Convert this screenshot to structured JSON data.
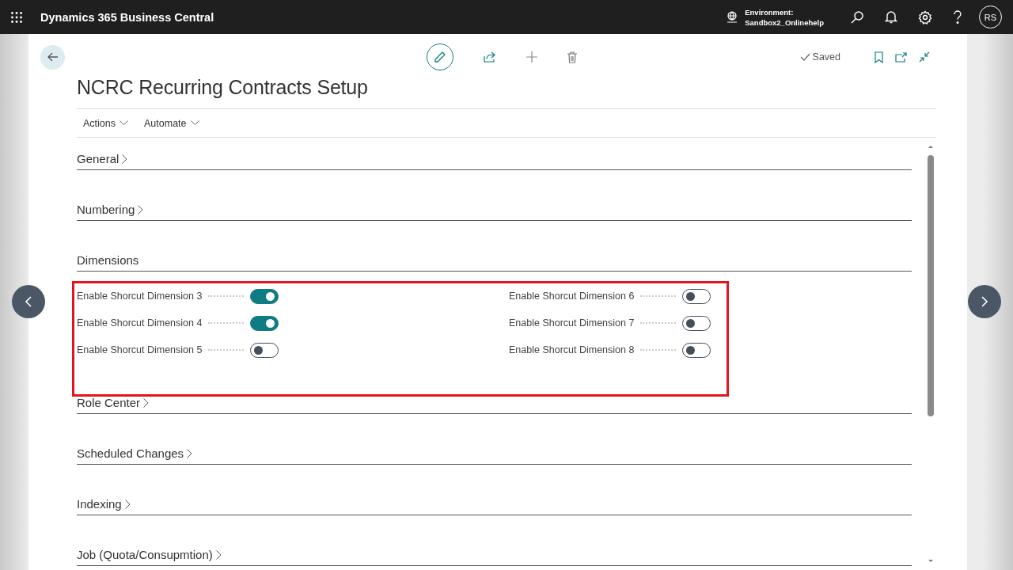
{
  "app_bar": {
    "title": "Dynamics 365 Business Central",
    "environment_label": "Environment:",
    "environment_name": "Sandbox2_Onlinehelp",
    "avatar": "RS"
  },
  "page": {
    "title": "NCRC Recurring Contracts Setup",
    "status": "Saved"
  },
  "action_menu": [
    {
      "label": "Actions"
    },
    {
      "label": "Automate"
    }
  ],
  "sections": [
    {
      "title": "General",
      "expanded": false
    },
    {
      "title": "Numbering",
      "expanded": false
    },
    {
      "title": "Dimensions",
      "expanded": true,
      "fields": [
        {
          "label": "Enable Shorcut Dimension 3",
          "on": true
        },
        {
          "label": "Enable Shorcut Dimension 4",
          "on": true
        },
        {
          "label": "Enable Shorcut Dimension 5",
          "on": false
        },
        {
          "label": "Enable Shorcut Dimension 6",
          "on": false
        },
        {
          "label": "Enable Shorcut Dimension 7",
          "on": false
        },
        {
          "label": "Enable Shorcut Dimension 8",
          "on": false
        }
      ]
    },
    {
      "title": "Role Center",
      "expanded": false
    },
    {
      "title": "Scheduled Changes",
      "expanded": false
    },
    {
      "title": "Indexing",
      "expanded": false
    },
    {
      "title": "Job (Quota/Consupmtion)",
      "expanded": false
    }
  ]
}
